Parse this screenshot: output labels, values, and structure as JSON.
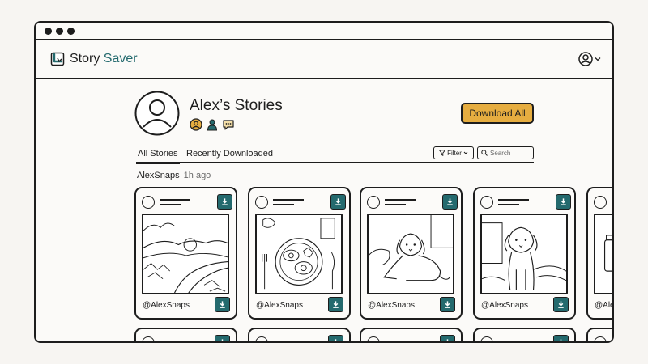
{
  "app": {
    "brand_prefix": "Story ",
    "brand_accent": "Saver"
  },
  "colors": {
    "accent": "#246a6e",
    "button": "#e6ad40"
  },
  "profile": {
    "title": "Alex’s Stories",
    "icons": [
      "user-circle-icon",
      "person-icon",
      "chat-bubble-icon"
    ]
  },
  "actions": {
    "download_all": "Download All"
  },
  "tabs": [
    {
      "label": "All Stories",
      "active": true
    },
    {
      "label": "Recently Downloaded",
      "active": false
    }
  ],
  "toolbar": {
    "filter_label": "Filter",
    "search_placeholder": "Search"
  },
  "group": {
    "author": "AlexSnaps",
    "time": "1h ago"
  },
  "cards": [
    {
      "handle": "@AlexSnaps",
      "image": "landscape"
    },
    {
      "handle": "@AlexSnaps",
      "image": "breakfast"
    },
    {
      "handle": "@AlexSnaps",
      "image": "dog-lying"
    },
    {
      "handle": "@AlexSnaps",
      "image": "dog-sitting"
    },
    {
      "handle": "@Ale",
      "image": "jar"
    }
  ]
}
